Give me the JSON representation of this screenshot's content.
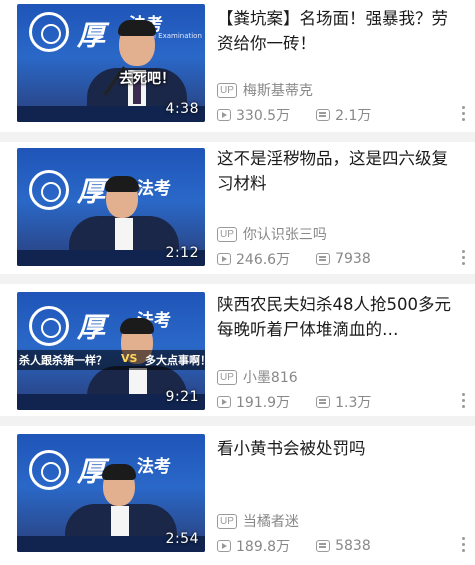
{
  "videos": [
    {
      "title": "【粪坑案】名场面！强暴我？劳资给你一砖！",
      "thumb_caption": "去死吧！",
      "duration": "4:38",
      "uploader": "梅斯基蒂克",
      "views": "330.5万",
      "danmaku": "2.1万"
    },
    {
      "title": "这不是淫秽物品，这是四六级复习材料",
      "thumb_caption": "",
      "duration": "2:12",
      "uploader": "你认识张三吗",
      "views": "246.6万",
      "danmaku": "7938"
    },
    {
      "title": "陕西农民夫妇杀48人抢500多元 每晚听着尸体堆滴血的…",
      "thumb_caption_left": "杀人跟杀猪一样？",
      "thumb_caption_vs": "VS",
      "thumb_caption_right": "多大点事啊！",
      "duration": "9:21",
      "uploader": "小墨816",
      "views": "191.9万",
      "danmaku": "1.3万"
    },
    {
      "title": "看小黄书会被处罚吗",
      "thumb_caption": "",
      "duration": "2:54",
      "uploader": "当橘者迷",
      "views": "189.8万",
      "danmaku": "5838"
    }
  ],
  "labels": {
    "up_badge": "UP",
    "brand_text": "厚",
    "brand_text2": "法考",
    "brand_sub": "Judicial Examination"
  },
  "icons": [
    "play-count-icon",
    "danmaku-icon",
    "more-options-icon",
    "uploader-badge-icon"
  ],
  "colors": {
    "thumb_bg": "#2a68c8",
    "meta_gray": "#888888"
  }
}
